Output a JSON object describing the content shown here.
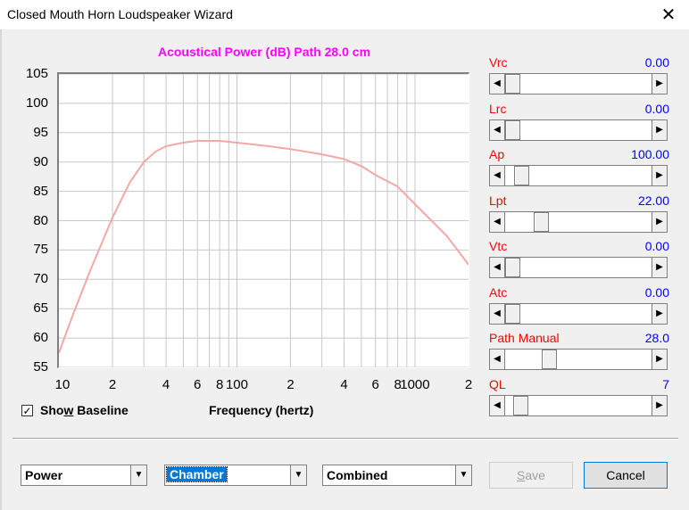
{
  "window": {
    "title": "Closed Mouth Horn Loudspeaker Wizard",
    "close_glyph": "✕"
  },
  "chart_title": "Acoustical Power (dB)   Path 28.0 cm",
  "chart_data": {
    "type": "line",
    "title": "Acoustical Power (dB)   Path 28.0 cm",
    "xlabel": "Frequency (hertz)",
    "ylabel": "",
    "xscale": "log",
    "xlim": [
      10,
      2000
    ],
    "ylim": [
      55,
      105
    ],
    "grid": true,
    "yticks": [
      "105",
      "100",
      "95",
      "90",
      "85",
      "80",
      "75",
      "70",
      "65",
      "60",
      "55"
    ],
    "xticks": [
      {
        "x": 10,
        "label": "10"
      },
      {
        "x": 20,
        "label": "2"
      },
      {
        "x": 40,
        "label": "4"
      },
      {
        "x": 60,
        "label": "6"
      },
      {
        "x": 80,
        "label": "8"
      },
      {
        "x": 100,
        "label": "100"
      },
      {
        "x": 200,
        "label": "2"
      },
      {
        "x": 400,
        "label": "4"
      },
      {
        "x": 600,
        "label": "6"
      },
      {
        "x": 800,
        "label": "8"
      },
      {
        "x": 1000,
        "label": "1000"
      },
      {
        "x": 2000,
        "label": "2"
      }
    ],
    "series": [
      {
        "color": "#f4a7a7",
        "x": [
          10,
          12,
          15,
          20,
          25,
          30,
          35,
          40,
          50,
          60,
          80,
          100,
          150,
          200,
          300,
          400,
          500,
          600,
          800,
          1000,
          1500,
          2000
        ],
        "y": [
          57.5,
          64.0,
          71.5,
          80.5,
          86.5,
          90.0,
          91.8,
          92.7,
          93.3,
          93.6,
          93.6,
          93.3,
          92.7,
          92.2,
          91.3,
          90.5,
          89.3,
          87.8,
          85.8,
          82.8,
          77.5,
          72.5
        ]
      }
    ]
  },
  "show_baseline": {
    "label_pre": "Sho",
    "label_ul": "w",
    "label_post": " Baseline",
    "checked": true,
    "check_glyph": "✓"
  },
  "params": [
    {
      "label": "Vrc",
      "value": "0.00",
      "level": 0.0
    },
    {
      "label": "Lrc",
      "value": "0.00",
      "level": 0.0
    },
    {
      "label": "Ap",
      "value": "100.00",
      "level": 0.07
    },
    {
      "label": "Lpt",
      "value": "22.00",
      "level": 0.22
    },
    {
      "label": "Vtc",
      "value": "0.00",
      "level": 0.0
    },
    {
      "label": "Atc",
      "value": "0.00",
      "level": 0.0
    },
    {
      "label": "Path  Manual",
      "value": "28.0",
      "level": 0.28
    },
    {
      "label": "QL",
      "value": "7",
      "level": 0.06
    }
  ],
  "scroll_glyphs": {
    "left": "◀",
    "right": "▶"
  },
  "combos": [
    {
      "value": "Power"
    },
    {
      "value": "Chamber"
    },
    {
      "value": "Combined"
    }
  ],
  "combo_arrow": "▼",
  "buttons": {
    "save": {
      "pre": "",
      "ul": "S",
      "post": "ave"
    },
    "cancel": "Cancel"
  }
}
